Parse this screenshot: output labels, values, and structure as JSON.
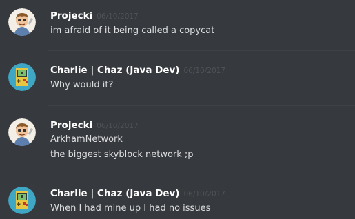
{
  "messages": [
    {
      "username": "Projecki",
      "timestamp": "06/10/2017",
      "avatar_icon": "cartoon-man-avatar-icon",
      "lines": [
        "im afraid of it being called a copycat"
      ]
    },
    {
      "username": "Charlie | Chaz (Java Dev)",
      "timestamp": "06/10/2017",
      "avatar_icon": "pixel-gameboy-avatar-icon",
      "lines": [
        "Why would it?"
      ]
    },
    {
      "username": "Projecki",
      "timestamp": "06/10/2017",
      "avatar_icon": "cartoon-man-avatar-icon",
      "lines": [
        "ArkhamNetwork",
        "the biggest skyblock network ;p"
      ]
    },
    {
      "username": "Charlie | Chaz (Java Dev)",
      "timestamp": "06/10/2017",
      "avatar_icon": "pixel-gameboy-avatar-icon",
      "lines": [
        "When I had mine up I had no issues"
      ]
    }
  ],
  "colors": {
    "background": "#36393e",
    "username": "#ffffff",
    "timestamp": "#4f5257",
    "message_text": "#dcddde",
    "divider": "#3e4146"
  }
}
